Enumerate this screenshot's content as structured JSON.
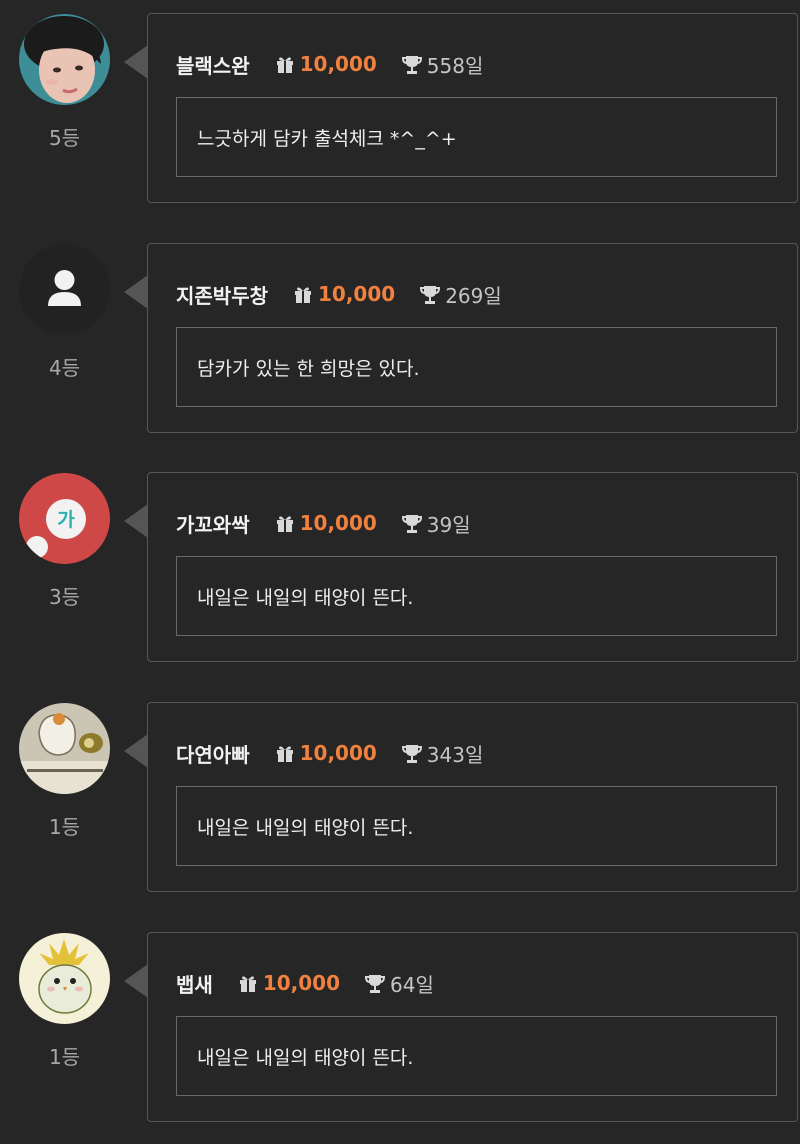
{
  "colors": {
    "background": "#262626",
    "points": "#f0813f",
    "card_border": "#565656"
  },
  "icons": {
    "gift": "gift-icon",
    "trophy": "trophy-icon"
  },
  "entries": [
    {
      "avatar": "photo-avatar-woman",
      "rank": "5등",
      "nickname": "블랙스완",
      "points": "10,000",
      "days": "558일",
      "message": "느긋하게 담카 출석체크 *^_^+"
    },
    {
      "avatar": "default-user-avatar",
      "rank": "4등",
      "nickname": "지존박두창",
      "points": "10,000",
      "days": "269일",
      "message": "담카가 있는 한 희망은 있다."
    },
    {
      "avatar": "letter-avatar",
      "avatar_letter": "가",
      "rank": "3등",
      "nickname": "가꼬와싹",
      "points": "10,000",
      "days": "39일",
      "message": "내일은 내일의 태양이 뜬다."
    },
    {
      "avatar": "photo-avatar-drawing",
      "rank": "1등",
      "nickname": "다연아빠",
      "points": "10,000",
      "days": "343일",
      "message": "내일은 내일의 태양이 뜬다."
    },
    {
      "avatar": "photo-avatar-bird",
      "rank": "1등",
      "nickname": "뱁새",
      "points": "10,000",
      "days": "64일",
      "message": "내일은 내일의 태양이 뜬다."
    }
  ]
}
